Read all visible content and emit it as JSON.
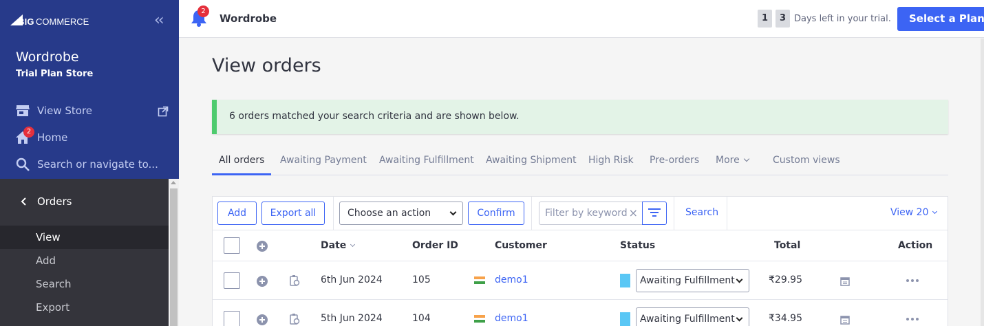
{
  "brand": {
    "logo_text": "BIGCOMMERCE",
    "accent": "#3c64f4",
    "sidebar_bg": "#273a8a"
  },
  "sidebar": {
    "store_name": "Wordrobe",
    "store_plan": "Trial Plan Store",
    "links": [
      {
        "label": "View Store",
        "icon": "storefront-icon"
      },
      {
        "label": "Home",
        "icon": "home-icon",
        "badge": "2"
      },
      {
        "label": "Search or navigate to...",
        "icon": "search-icon"
      }
    ],
    "section": "Orders",
    "sub_items": [
      {
        "label": "View",
        "active": true
      },
      {
        "label": "Add",
        "active": false
      },
      {
        "label": "Search",
        "active": false
      },
      {
        "label": "Export",
        "active": false
      }
    ]
  },
  "header": {
    "notification_count": "2",
    "store_name": "Wordrobe",
    "trial_digits": [
      "1",
      "3"
    ],
    "trial_text": "Days left in your trial.",
    "plan_button": "Select a Plan"
  },
  "main": {
    "title": "View orders",
    "alert": "6 orders matched your search criteria and are shown below.",
    "tabs": [
      {
        "label": "All orders",
        "active": true
      },
      {
        "label": "Awaiting Payment"
      },
      {
        "label": "Awaiting Fulfillment"
      },
      {
        "label": "Awaiting Shipment"
      },
      {
        "label": "High Risk"
      },
      {
        "label": "Pre-orders"
      },
      {
        "label": "More"
      },
      {
        "label": "Custom views"
      }
    ],
    "toolbar": {
      "add": "Add",
      "export_all": "Export all",
      "action_select": "Choose an action",
      "confirm": "Confirm",
      "filter_placeholder": "Filter by keyword",
      "search": "Search",
      "view": "View 20"
    },
    "columns": {
      "date": "Date",
      "order_id": "Order ID",
      "customer": "Customer",
      "status": "Status",
      "total": "Total",
      "action": "Action"
    },
    "orders": [
      {
        "date": "6th Jun 2024",
        "order_id": "105",
        "customer": "demo1",
        "status": "Awaiting Fulfillment",
        "total": "₹29.95"
      },
      {
        "date": "5th Jun 2024",
        "order_id": "104",
        "customer": "demo1",
        "status": "Awaiting Fulfillment",
        "total": "₹34.95"
      }
    ]
  }
}
